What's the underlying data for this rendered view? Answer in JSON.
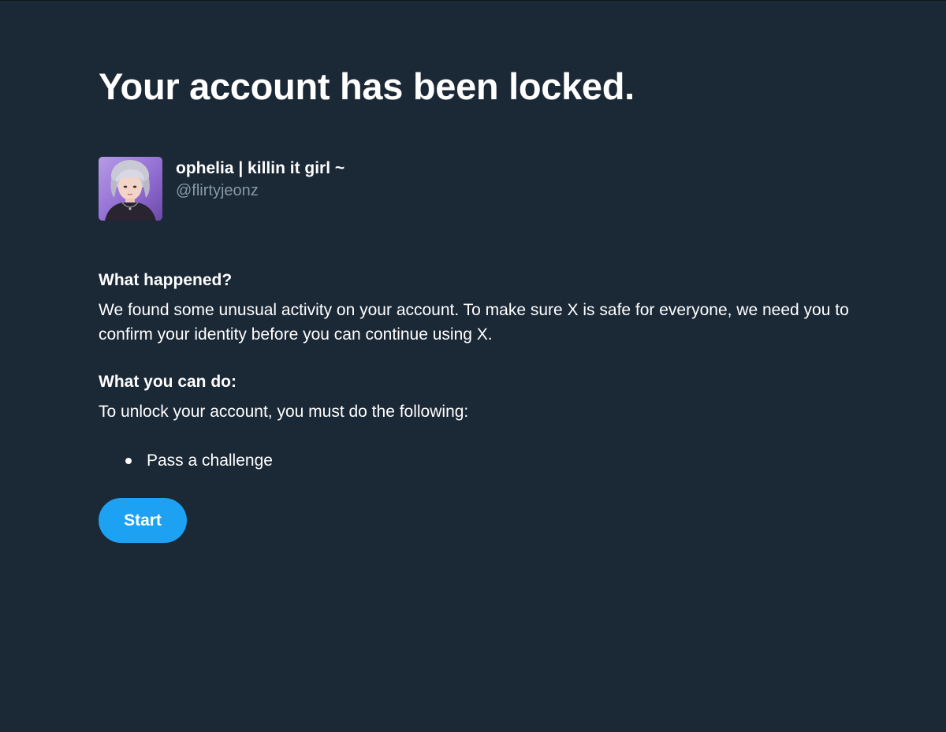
{
  "page": {
    "title": "Your account has been locked."
  },
  "account": {
    "display_name": "ophelia | killin it girl ~",
    "handle": "@flirtyjeonz",
    "avatar_icon": "profile-photo"
  },
  "sections": [
    {
      "heading": "What happened?",
      "body": "We found some unusual activity on your account. To make sure X is safe for everyone, we need you to confirm your identity before you can continue using X."
    },
    {
      "heading": "What you can do:",
      "body": "To unlock your account, you must do the following:"
    }
  ],
  "tasks": [
    {
      "label": "Pass a challenge"
    }
  ],
  "actions": {
    "start_label": "Start"
  },
  "colors": {
    "background": "#1b2836",
    "text": "#ffffff",
    "secondary_text": "#8899a6",
    "accent": "#1da1f2"
  }
}
